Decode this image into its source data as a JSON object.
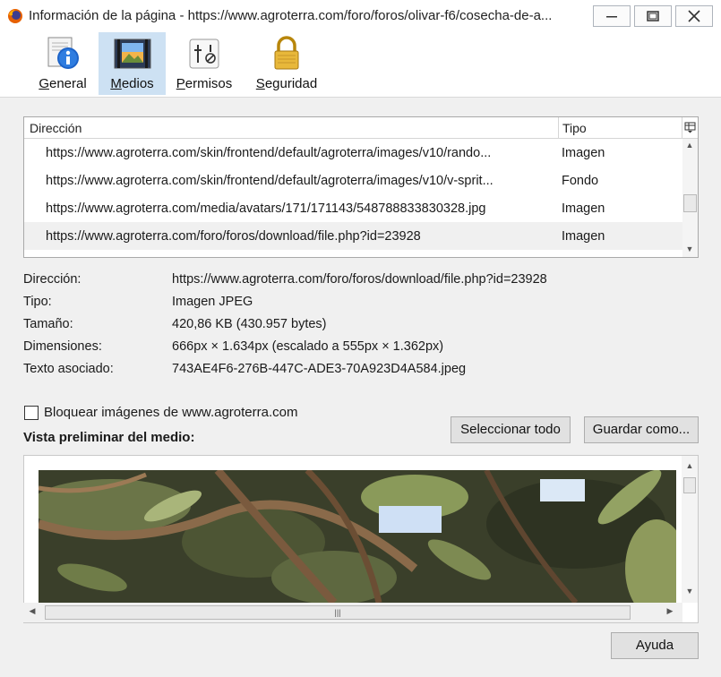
{
  "window": {
    "title": "Información de la página - https://www.agroterra.com/foro/foros/olivar-f6/cosecha-de-a..."
  },
  "toolbar": {
    "tabs": [
      {
        "label": "General",
        "icon": "info-icon"
      },
      {
        "label": "Medios",
        "icon": "media-icon",
        "active": true
      },
      {
        "label": "Permisos",
        "icon": "permissions-icon"
      },
      {
        "label": "Seguridad",
        "icon": "lock-icon"
      }
    ]
  },
  "media_table": {
    "headers": {
      "address": "Dirección",
      "type": "Tipo"
    },
    "rows": [
      {
        "url": "https://www.agroterra.com/skin/frontend/default/agroterra/images/v10/rando...",
        "type": "Imagen"
      },
      {
        "url": "https://www.agroterra.com/skin/frontend/default/agroterra/images/v10/v-sprit...",
        "type": "Fondo"
      },
      {
        "url": "https://www.agroterra.com/media/avatars/171/171143/548788833830328.jpg",
        "type": "Imagen"
      },
      {
        "url": "https://www.agroterra.com/foro/foros/download/file.php?id=23928",
        "type": "Imagen",
        "selected": true
      }
    ]
  },
  "details": {
    "address_label": "Dirección:",
    "address_value": "https://www.agroterra.com/foro/foros/download/file.php?id=23928",
    "type_label": "Tipo:",
    "type_value": "Imagen JPEG",
    "size_label": "Tamaño:",
    "size_value": "420,86 KB (430.957 bytes)",
    "dimensions_label": "Dimensiones:",
    "dimensions_value": "666px × 1.634px (escalado a 555px × 1.362px)",
    "alt_label": "Texto asociado:",
    "alt_value": "743AE4F6-276B-447C-ADE3-70A923D4A584.jpeg"
  },
  "block_images": {
    "label": "Bloquear imágenes de www.agroterra.com",
    "checked": false
  },
  "preview": {
    "label": "Vista preliminar del medio:"
  },
  "buttons": {
    "select_all": "Seleccionar todo",
    "save_as": "Guardar como...",
    "help": "Ayuda"
  },
  "colors": {
    "active_tab": "#cde1f3",
    "window_bg": "#f0f0f0"
  }
}
